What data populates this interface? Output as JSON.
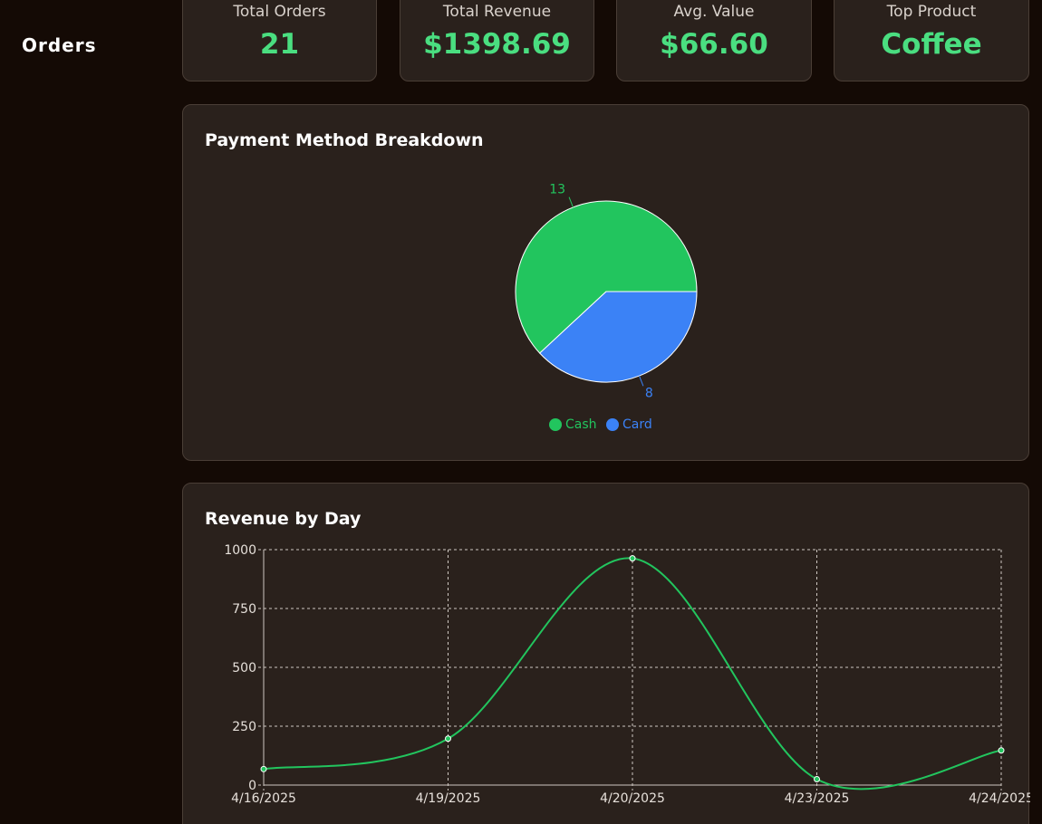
{
  "sidebar": {
    "title": "Orders"
  },
  "stats": [
    {
      "label": "Total Orders",
      "value": "21"
    },
    {
      "label": "Total Revenue",
      "value": "$1398.69"
    },
    {
      "label": "Avg. Value",
      "value": "$66.60"
    },
    {
      "label": "Top Product",
      "value": "Coffee"
    }
  ],
  "payment_panel": {
    "title": "Payment Method Breakdown"
  },
  "revenue_panel": {
    "title": "Revenue by Day"
  },
  "colors": {
    "accent": "#4ade80",
    "cash": "#22c55e",
    "card": "#3b82f6",
    "panel": "#2a211c",
    "background": "#140a05"
  },
  "chart_data": [
    {
      "type": "pie",
      "title": "Payment Method Breakdown",
      "categories": [
        "Cash",
        "Card"
      ],
      "values": [
        13,
        8
      ],
      "colors": [
        "#22c55e",
        "#3b82f6"
      ],
      "legend": "bottom"
    },
    {
      "type": "line",
      "title": "Revenue by Day",
      "x": [
        "4/16/2025",
        "4/19/2025",
        "4/20/2025",
        "4/23/2025",
        "4/24/2025"
      ],
      "series": [
        {
          "values": [
            68,
            197,
            963,
            25,
            147
          ],
          "color": "#22c55e"
        }
      ],
      "ylim": [
        0,
        1000
      ],
      "yticks": [
        0,
        250,
        500,
        750,
        1000
      ],
      "grid": true
    }
  ]
}
